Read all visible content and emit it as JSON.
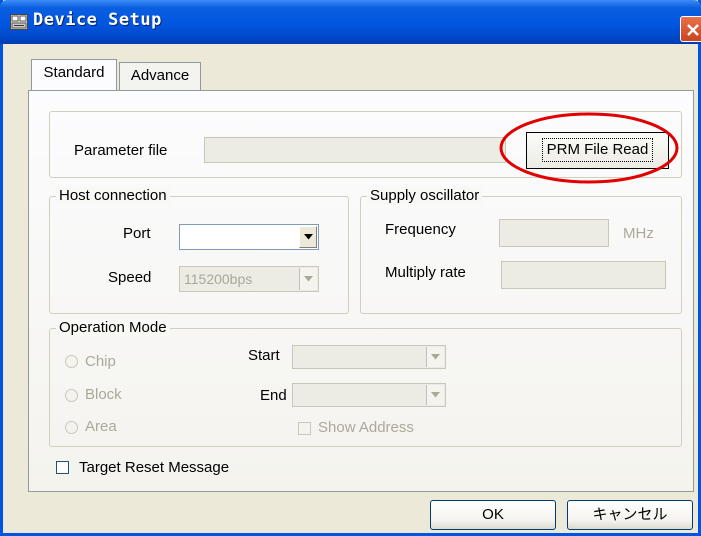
{
  "window": {
    "title": "Device Setup"
  },
  "tabs": [
    {
      "label": "Standard",
      "active": true
    },
    {
      "label": "Advance",
      "active": false
    }
  ],
  "parameter_file": {
    "label": "Parameter file",
    "value": "",
    "button_label": "PRM File Read"
  },
  "host_connection": {
    "legend": "Host connection",
    "port_label": "Port",
    "port_value": "",
    "speed_label": "Speed",
    "speed_value": "115200bps"
  },
  "supply_oscillator": {
    "legend": "Supply oscillator",
    "frequency_label": "Frequency",
    "frequency_value": "",
    "frequency_unit": "MHz",
    "multiply_label": "Multiply rate",
    "multiply_value": ""
  },
  "operation_mode": {
    "legend": "Operation Mode",
    "options": [
      "Chip",
      "Block",
      "Area"
    ],
    "start_label": "Start",
    "start_value": "",
    "end_label": "End",
    "end_value": "",
    "show_address_label": "Show Address"
  },
  "target_reset": {
    "label": "Target Reset Message",
    "checked": false
  },
  "buttons": {
    "ok": "OK",
    "cancel": "キャンセル"
  },
  "colors": {
    "titlebar": "#0054e3",
    "dialog_bg": "#ece9d8",
    "highlight": "#e00000"
  }
}
